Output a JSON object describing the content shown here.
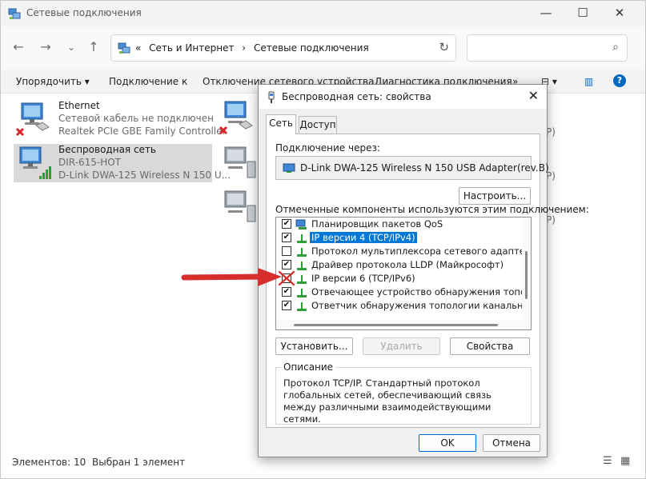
{
  "window": {
    "title": "Сетевые подключения",
    "minimize_glyph": "—",
    "maximize_glyph": "☐",
    "close_glyph": "✕"
  },
  "nav": {
    "back_glyph": "←",
    "forward_glyph": "→",
    "dropdown_glyph": "⌄",
    "up_glyph": "↑"
  },
  "address": {
    "chevron": "«",
    "crumbs": [
      "Сеть и Интернет",
      "›",
      "Сетевые подключения"
    ],
    "refresh_glyph": "↻"
  },
  "search": {
    "placeholder": "",
    "icon_glyph": "⌕"
  },
  "commandbar": {
    "organize": "Упорядочить ▾",
    "connect": "Подключение к",
    "disconnect": "Отключение сетевого устройства",
    "diagnose": "Диагностика подключения",
    "more": "»",
    "view": "⊟ ▾",
    "pane": "▥",
    "help": "?"
  },
  "connections": [
    {
      "name": "Ethernet",
      "status": "Сетевой кабель не подключен",
      "adapter": "Realtek PCIe GBE Family Controller",
      "selected": false
    },
    {
      "name": "Беспроводная сеть",
      "status": "DIR-615-HOT",
      "adapter": "D-Link DWA-125 Wireless N 150 U...",
      "selected": true
    }
  ],
  "col2_partial": [
    "P)",
    "P)",
    "P)"
  ],
  "statusbar": {
    "count": "Элементов: 10",
    "selected": "Выбран 1 элемент"
  },
  "dialog": {
    "title": "Беспроводная сеть: свойства",
    "close_glyph": "✕",
    "tabs": [
      "Сеть",
      "Доступ"
    ],
    "connect_using_label": "Подключение через:",
    "adapter_name": "D-Link DWA-125 Wireless N 150 USB Adapter(rev.B)",
    "configure_button": "Настроить...",
    "components_label": "Отмеченные компоненты используются этим подключением:",
    "components": [
      {
        "label": "Планировщик пакетов QoS",
        "checked": true,
        "check_glyph": "✔",
        "selected": false
      },
      {
        "label": "IP версии 4 (TCP/IPv4)",
        "checked": true,
        "check_glyph": "✔",
        "selected": true
      },
      {
        "label": "Протокол мультиплексора сетевого адаптера (Май",
        "checked": false,
        "check_glyph": "",
        "selected": false
      },
      {
        "label": "Драйвер протокола LLDP (Майкрософт)",
        "checked": true,
        "check_glyph": "✔",
        "selected": false
      },
      {
        "label": "IP версии 6 (TCP/IPv6)",
        "checked": false,
        "check_glyph": "",
        "selected": false,
        "crossed": true
      },
      {
        "label": "Отвечающее устройство обнаружения топологии к",
        "checked": true,
        "check_glyph": "✔",
        "selected": false
      },
      {
        "label": "Ответчик обнаружения топологии канального уров",
        "checked": true,
        "check_glyph": "✔",
        "selected": false
      }
    ],
    "install_button": "Установить...",
    "remove_button": "Удалить",
    "properties_button": "Свойства",
    "description_title": "Описание",
    "description_text": "Протокол TCP/IP. Стандартный протокол глобальных сетей, обеспечивающий связь между различными взаимодействующими сетями.",
    "ok_button": "OK",
    "cancel_button": "Отмена"
  },
  "colors": {
    "selection": "#0078d7",
    "arrow": "#d62d2d",
    "selected_item_bg": "#d9d9d9"
  }
}
